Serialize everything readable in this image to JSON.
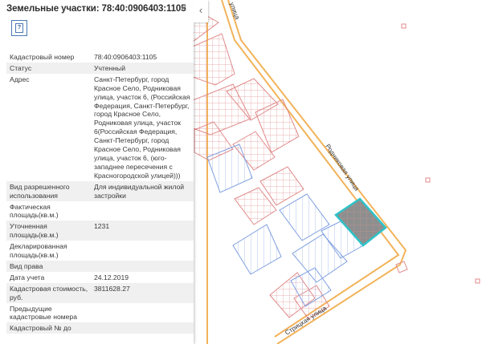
{
  "panel": {
    "title": "Земельные участки: 78:40:0906403:1105",
    "close_label": "×",
    "doc_icon": "document-icon",
    "doc_label": "?",
    "collapse_label": "‹"
  },
  "attributes": [
    {
      "key": "Кадастровый номер",
      "value": "78:40:0906403:1105"
    },
    {
      "key": "Статус",
      "value": "Учтенный"
    },
    {
      "key": "Адрес",
      "value": "Санкт-Петербург, город Красное Село, Родниковая улица, участок 6, (Российская Федерация, Санкт-Петербург, город Красное Село, Родниковая улица, участок 6(Российская Федерация, Санкт-Петербург, город Красное Село, Родниковая улица, участок 6, (юго-западнее пересечения с Красногородской улицей)))"
    },
    {
      "key": "Вид разрешенного использования",
      "value": "Для индивидуальной жилой застройки"
    },
    {
      "key": "Фактическая площадь(кв.м.)",
      "value": ""
    },
    {
      "key": "Уточненная площадь(кв.м.)",
      "value": "1231"
    },
    {
      "key": "Декларированная площадь(кв.м.)",
      "value": ""
    },
    {
      "key": "Вид права",
      "value": ""
    },
    {
      "key": "Дата учета",
      "value": "24.12.2019"
    },
    {
      "key": "Кадастровая стоимость, руб.",
      "value": "3811628.27"
    },
    {
      "key": "Предыдущие кадастровые номера",
      "value": ""
    },
    {
      "key": "Кадастровый № до",
      "value": ""
    }
  ],
  "map": {
    "road_rodnikovaya": "Родниковая улица",
    "road_streltsa": "Стрицкая улица",
    "road_top": "улица",
    "colors": {
      "parcel_red": "#e08a8a",
      "parcel_blue": "#7f9fe0",
      "road": "#f2b35a",
      "selected": "#8e8e8e",
      "selected_outline": "#2cc3c8"
    }
  }
}
